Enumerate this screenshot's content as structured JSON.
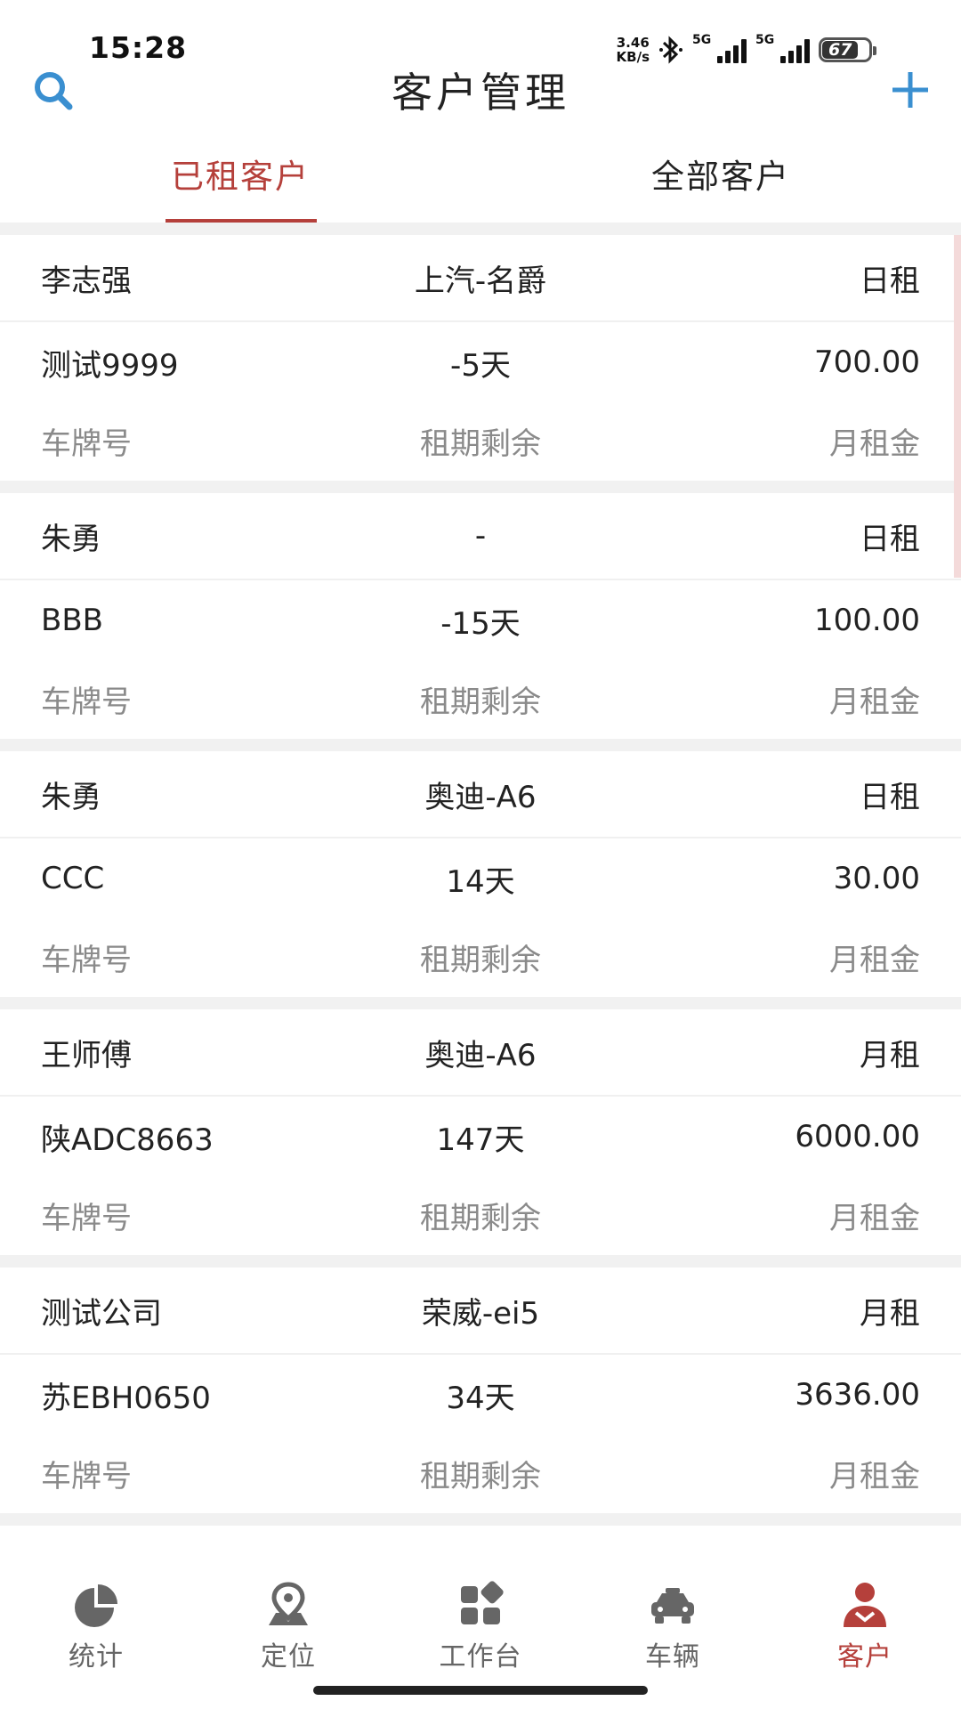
{
  "status_bar": {
    "time": "15:28",
    "net_speed_value": "3.46",
    "net_speed_unit": "KB/s",
    "signal1_label": "5G",
    "signal2_label": "5G",
    "battery_level": "67"
  },
  "header": {
    "title": "客户管理",
    "search_icon": "search-icon",
    "add_icon": "plus-icon"
  },
  "tabs": [
    {
      "label": "已租客户",
      "active": true
    },
    {
      "label": "全部客户",
      "active": false
    }
  ],
  "customers": [
    {
      "name": "李志强",
      "model": "上汽-名爵",
      "rent_type": "日租",
      "plate": "测试9999",
      "remaining": "-5天",
      "monthly_rent": "700.00"
    },
    {
      "name": "朱勇",
      "model": "-",
      "rent_type": "日租",
      "plate": "BBB",
      "remaining": "-15天",
      "monthly_rent": "100.00"
    },
    {
      "name": "朱勇",
      "model": "奥迪-A6",
      "rent_type": "日租",
      "plate": "CCC",
      "remaining": "14天",
      "monthly_rent": "30.00"
    },
    {
      "name": "王师傅",
      "model": "奥迪-A6",
      "rent_type": "月租",
      "plate": "陕ADC8663",
      "remaining": "147天",
      "monthly_rent": "6000.00"
    },
    {
      "name": "测试公司",
      "model": "荣威-ei5",
      "rent_type": "月租",
      "plate": "苏EBH0650",
      "remaining": "34天",
      "monthly_rent": "3636.00"
    }
  ],
  "field_labels": {
    "plate": "车牌号",
    "remaining": "租期剩余",
    "monthly_rent": "月租金"
  },
  "bottom_nav": [
    {
      "label": "统计",
      "icon": "pie-chart-icon",
      "active": false
    },
    {
      "label": "定位",
      "icon": "location-pin-icon",
      "active": false
    },
    {
      "label": "工作台",
      "icon": "dashboard-icon",
      "active": false
    },
    {
      "label": "车辆",
      "icon": "car-icon",
      "active": false
    },
    {
      "label": "客户",
      "icon": "customer-icon",
      "active": true
    }
  ],
  "colors": {
    "accent": "#b5403b",
    "header_blue": "#3a8fd0",
    "label_gray": "#8a8a8a"
  }
}
